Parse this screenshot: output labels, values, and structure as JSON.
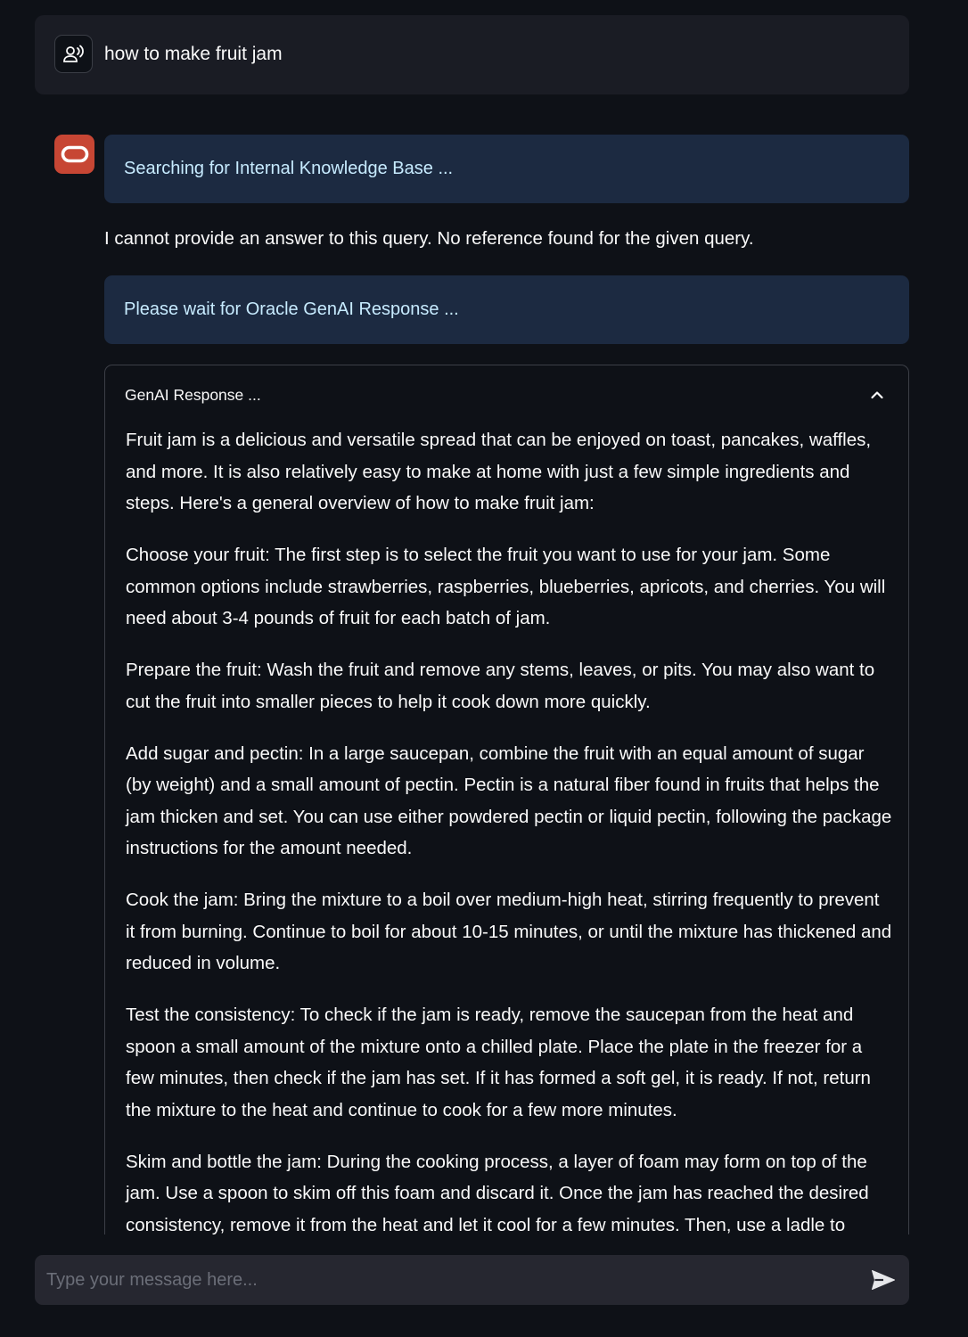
{
  "user_message": {
    "avatar_icon": "user-speaking-icon",
    "text": "how to make fruit jam"
  },
  "assistant": {
    "avatar_icon": "oracle-logo-icon",
    "avatar_color": "#c74634",
    "info_searching": "Searching for Internal Knowledge Base ...",
    "no_answer_text": "I cannot provide an answer to this query. No reference found for the given query.",
    "info_waiting": "Please wait for Oracle GenAI Response ...",
    "expander": {
      "title": "GenAI Response ...",
      "toggle_icon": "chevron-up-icon",
      "paragraphs": [
        "Fruit jam is a delicious and versatile spread that can be enjoyed on toast, pancakes, waffles, and more. It is also relatively easy to make at home with just a few simple ingredients and steps. Here's a general overview of how to make fruit jam:",
        "Choose your fruit: The first step is to select the fruit you want to use for your jam. Some common options include strawberries, raspberries, blueberries, apricots, and cherries. You will need about 3-4 pounds of fruit for each batch of jam.",
        "Prepare the fruit: Wash the fruit and remove any stems, leaves, or pits. You may also want to cut the fruit into smaller pieces to help it cook down more quickly.",
        "Add sugar and pectin: In a large saucepan, combine the fruit with an equal amount of sugar (by weight) and a small amount of pectin. Pectin is a natural fiber found in fruits that helps the jam thicken and set. You can use either powdered pectin or liquid pectin, following the package instructions for the amount needed.",
        "Cook the jam: Bring the mixture to a boil over medium-high heat, stirring frequently to prevent it from burning. Continue to boil for about 10-15 minutes, or until the mixture has thickened and reduced in volume.",
        "Test the consistency: To check if the jam is ready, remove the saucepan from the heat and spoon a small amount of the mixture onto a chilled plate. Place the plate in the freezer for a few minutes, then check if the jam has set. If it has formed a soft gel, it is ready. If not, return the mixture to the heat and continue to cook for a few more minutes.",
        "Skim and bottle the jam: During the cooking process, a layer of foam may form on top of the jam. Use a spoon to skim off this foam and discard it. Once the jam has reached the desired consistency, remove it from the heat and let it cool for a few minutes. Then, use a ladle to"
      ]
    }
  },
  "chat_input": {
    "placeholder": "Type your message here...",
    "value": "",
    "send_icon": "send-icon"
  },
  "colors": {
    "background": "#0e1117",
    "info_background": "#1c2a41",
    "info_text": "#c7ebff",
    "input_background": "#262730"
  }
}
